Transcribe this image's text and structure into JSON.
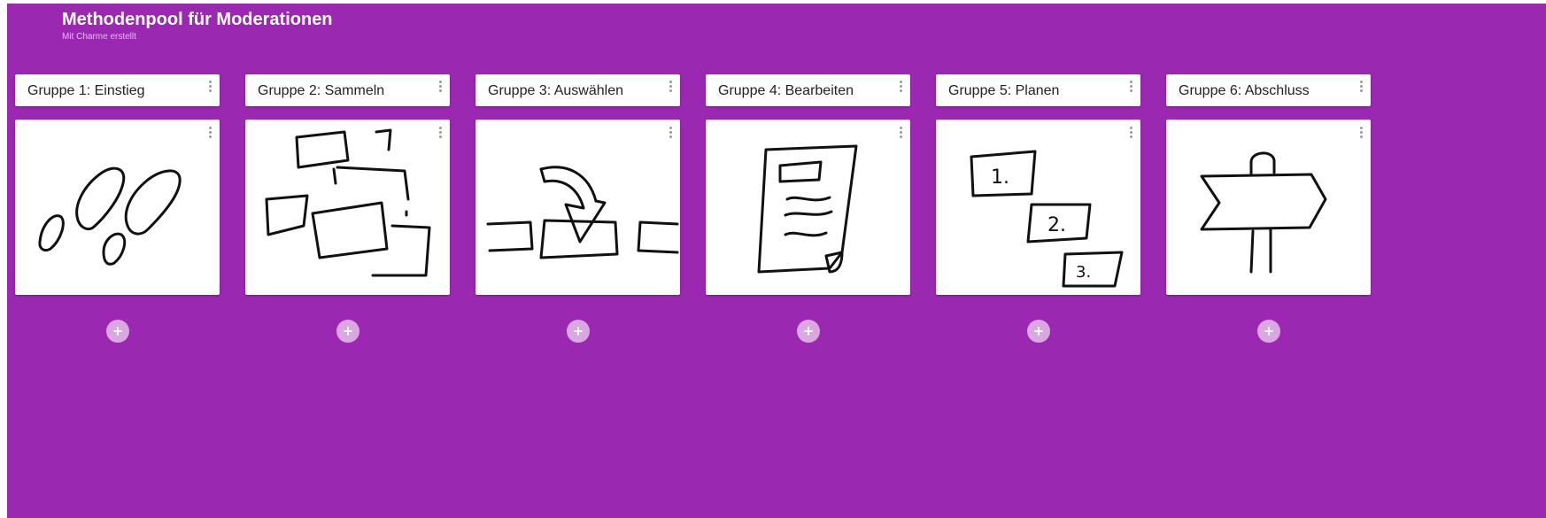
{
  "board": {
    "title": "Methodenpool für Moderationen",
    "subtitle": "Mit Charme erstellt",
    "background_color": "#9b28b0"
  },
  "columns": [
    {
      "label": "Gruppe 1: Einstieg",
      "card_icon": "footprints-icon",
      "add_label": "+"
    },
    {
      "label": "Gruppe 2: Sammeln",
      "card_icon": "scattered-notes-icon",
      "add_label": "+"
    },
    {
      "label": "Gruppe 3: Auswählen",
      "card_icon": "select-arrow-icon",
      "add_label": "+"
    },
    {
      "label": "Gruppe 4: Bearbeiten",
      "card_icon": "document-icon",
      "add_label": "+"
    },
    {
      "label": "Gruppe 5: Planen",
      "card_icon": "numbered-steps-icon",
      "add_label": "+"
    },
    {
      "label": "Gruppe 6: Abschluss",
      "card_icon": "signpost-icon",
      "add_label": "+"
    }
  ],
  "steps_icon_labels": [
    "1.",
    "2.",
    "3."
  ]
}
